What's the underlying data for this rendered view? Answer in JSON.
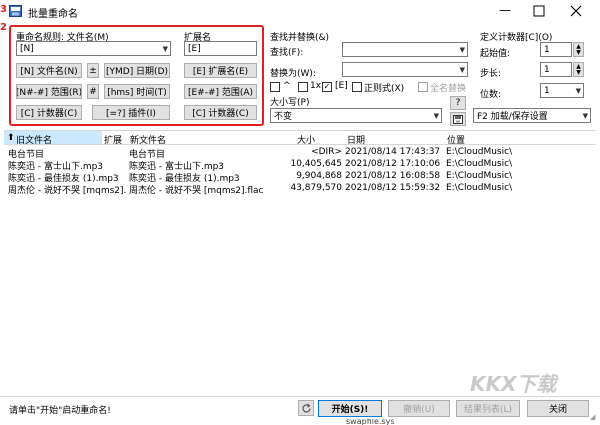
{
  "window": {
    "title": "批量重命名",
    "side_numbers": [
      "3",
      "2"
    ]
  },
  "rule": {
    "name_label": "重命名规则: 文件名(M)",
    "name_value": "[N]",
    "buttons": [
      "[N] 文件名(N)",
      "±",
      "[YMD] 日期(D)",
      "[N#-#] 范围(R)",
      "#",
      "[hms] 时间(T)",
      "[C] 计数器(C)",
      "[=?] 插件(I)"
    ]
  },
  "ext": {
    "label": "扩展名",
    "value": "[E]",
    "buttons": [
      "[E] 扩展名(E)",
      "[E#-#] 范围(A)",
      "[C] 计数器(C)"
    ]
  },
  "search": {
    "group_label": "查找并替换(&)",
    "find_label": "查找(F):",
    "replace_label": "替换为(W):",
    "options": [
      "^",
      "1x",
      "[E]",
      "正则式(X)",
      "全名替换"
    ],
    "options_checked": [
      false,
      false,
      true,
      false,
      false
    ],
    "help_label": "?"
  },
  "case": {
    "label": "大小写(P)",
    "value": "不变"
  },
  "counter": {
    "group_label": "定义计数器[C](O)",
    "start_label": "起始值:",
    "start_value": "1",
    "step_label": "步长:",
    "step_value": "1",
    "digits_label": "位数:",
    "digits_value": "1",
    "preset_label": "F2 加载/保存设置"
  },
  "list": {
    "columns": [
      "旧文件名",
      "扩展",
      "新文件名",
      "大小",
      "日期",
      "位置"
    ],
    "rows": [
      {
        "old": "电台节目",
        "ext": "",
        "new": "电台节目",
        "size": "<DIR>",
        "date": "2021/08/14 17:43:37",
        "path": "E:\\CloudMusic\\"
      },
      {
        "old": "陈奕迅 - 富士山下.mp3",
        "ext": "",
        "new": "陈奕迅 - 富士山下.mp3",
        "size": "10,405,645",
        "date": "2021/08/12 17:10:06",
        "path": "E:\\CloudMusic\\"
      },
      {
        "old": "陈奕迅 - 最佳损友 (1).mp3",
        "ext": "",
        "new": "陈奕迅 - 最佳损友 (1).mp3",
        "size": "9,904,868",
        "date": "2021/08/12 16:08:58",
        "path": "E:\\CloudMusic\\"
      },
      {
        "old": "周杰伦 - 说好不哭 [mqms2]...",
        "ext": "",
        "new": "周杰伦 - 说好不哭 [mqms2].flac",
        "size": "43,879,570",
        "date": "2021/08/12 15:59:32",
        "path": "E:\\CloudMusic\\"
      }
    ]
  },
  "status": {
    "message": "请单击\"开始\"启动重命名!",
    "start": "开始(S)!",
    "undo": "撤销(U)",
    "result_list": "结果列表(L)",
    "close": "关闭"
  },
  "watermark": "KKX下载",
  "footer_fragment": "swapfile.sys",
  "colors": {
    "accent_red": "#e02020",
    "selected_header": "#cce8ff"
  }
}
